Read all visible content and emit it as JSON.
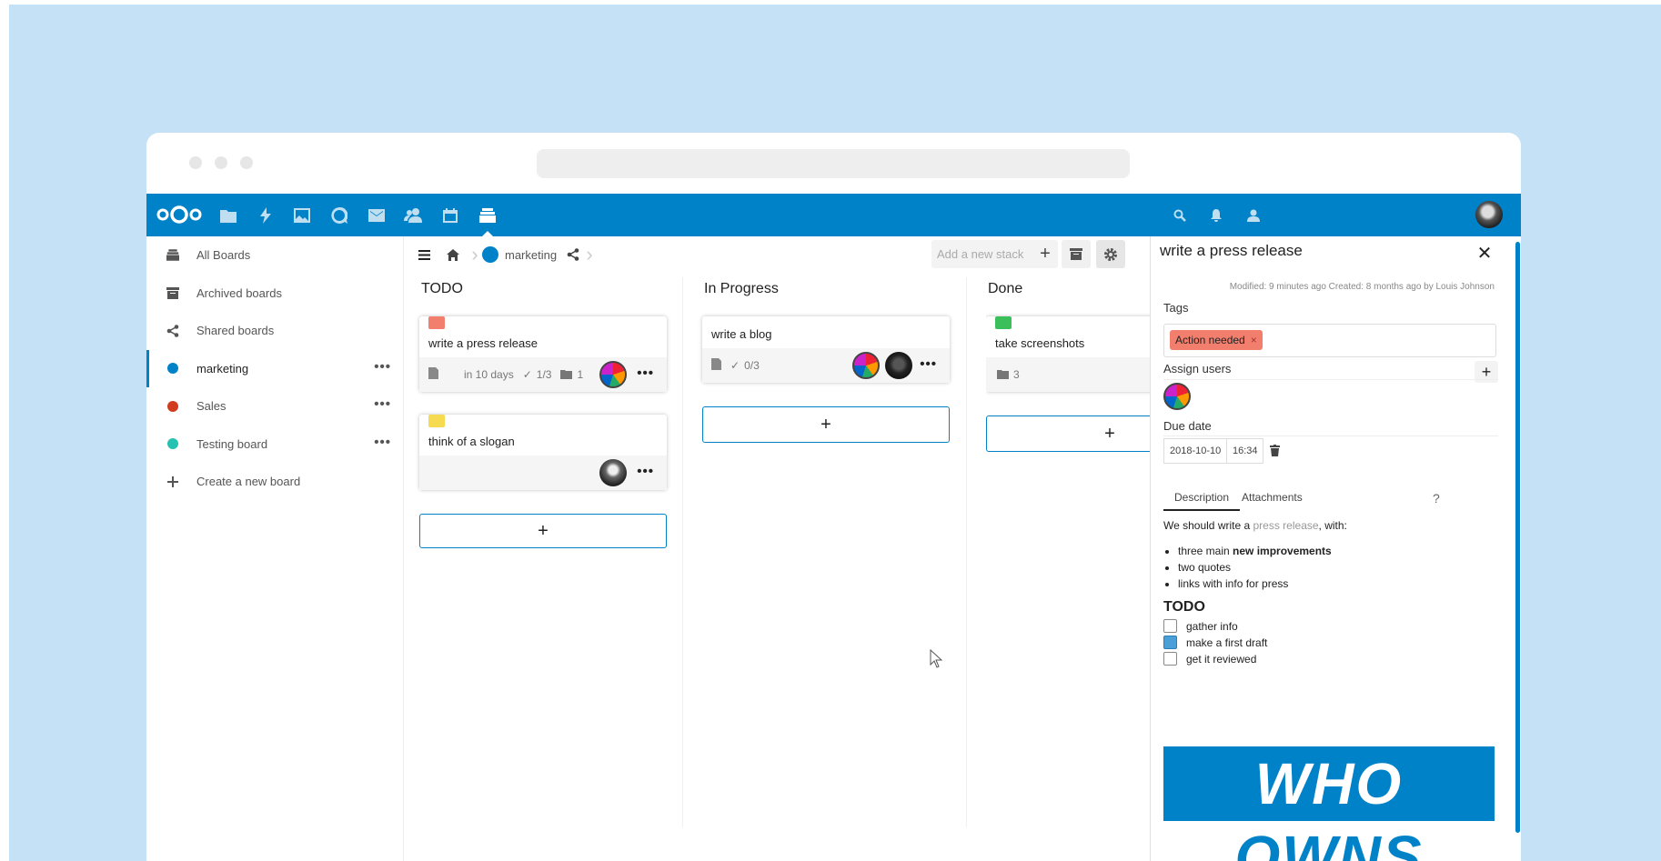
{
  "colors": {
    "brand": "#0082c9",
    "background": "#c5e1f6",
    "label_red": "#f27f6d",
    "label_yellow": "#f6da4f",
    "label_green": "#3bbf5a",
    "sales": "#d13c1e",
    "testing": "#26c2b1"
  },
  "topbar": {
    "apps": [
      "files-icon",
      "activity-icon",
      "gallery-icon",
      "talk-icon",
      "mail-icon",
      "contacts-icon",
      "calendar-icon",
      "deck-icon"
    ],
    "right": [
      "search-icon",
      "notifications-icon",
      "contacts-menu-icon",
      "user-avatar"
    ]
  },
  "sidebar": {
    "items": [
      {
        "label": "All Boards",
        "icon": "boards-icon"
      },
      {
        "label": "Archived boards",
        "icon": "archive-icon"
      },
      {
        "label": "Shared boards",
        "icon": "share-icon"
      },
      {
        "label": "marketing",
        "color": "#0082c9"
      },
      {
        "label": "Sales",
        "color": "#d13c1e"
      },
      {
        "label": "Testing board",
        "color": "#26c2b1"
      },
      {
        "label": "Create a new board",
        "icon": "plus-icon"
      }
    ],
    "menu": "•••"
  },
  "board": {
    "name": "marketing",
    "add_stack_placeholder": "Add a new stack",
    "stacks": [
      {
        "title": "TODO",
        "cards": [
          {
            "title": "write a press release",
            "label_color": "#f27f6d",
            "due": "in 10 days",
            "checklist": "1/3",
            "attachments": "1"
          },
          {
            "title": "think of a slogan",
            "label_color": "#f6da4f"
          }
        ]
      },
      {
        "title": "In Progress",
        "cards": [
          {
            "title": "write a blog",
            "checklist": "0/3"
          }
        ]
      },
      {
        "title": "Done",
        "cards": [
          {
            "title": "take screenshots",
            "label_color": "#3bbf5a",
            "attachments": "3"
          }
        ]
      }
    ],
    "add_card": "+",
    "card_menu": "•••"
  },
  "detail": {
    "title": "write a press release",
    "close": "✕",
    "modified": "Modified: 9 minutes ago Created: 8 months ago by Louis Johnson",
    "tags_label": "Tags",
    "tag": "Action needed",
    "tag_remove": "×",
    "assign_label": "Assign users",
    "add": "+",
    "due_label": "Due date",
    "due_date": "2018-10-10",
    "due_time": "16:34",
    "tabs": [
      "Description",
      "Attachments"
    ],
    "help": "?",
    "desc": {
      "intro_a": "We should write a ",
      "intro_link": "press release",
      "intro_b": ", with:",
      "bullets": [
        {
          "a": "three main ",
          "b": "new improvements"
        },
        {
          "a": "two quotes",
          "b": ""
        },
        {
          "a": "links with info for press",
          "b": ""
        }
      ],
      "heading": "TODO",
      "checklist": [
        {
          "text": "gather info",
          "checked": false
        },
        {
          "text": "make a first draft",
          "checked": true
        },
        {
          "text": "get it reviewed",
          "checked": false
        }
      ]
    },
    "image_text": [
      "WHO",
      "OWNS"
    ]
  }
}
